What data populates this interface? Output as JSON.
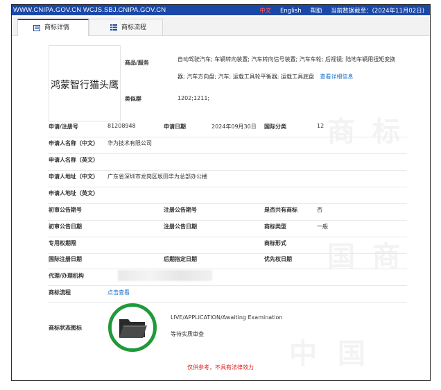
{
  "topbar": {
    "url": "WWW.CNIPA.GOV.CN WCJS.SBJ.CNIPA.GOV.CN",
    "lang_zh": "中文",
    "lang_en": "English",
    "help": "帮助",
    "data_date": "当前数据截至：(2024年11月02日)"
  },
  "tabs": [
    {
      "label": "商标详情",
      "icon": "document-icon",
      "active": true
    },
    {
      "label": "商标流程",
      "icon": "list-icon",
      "active": false
    }
  ],
  "mark": {
    "text": "鸿蒙智行猫头鹰"
  },
  "goods": {
    "label": "商品/服务",
    "text": "自动驾驶汽车; 车辆转向装置; 汽车转向信号装置; 汽车车轮; 后视镜; 陆地车辆用扭矩变换器; 汽车方向盘; 汽车; 运载工具轮平衡器; 运载工具底盘",
    "more_link": "查看详细信息"
  },
  "similar_group": {
    "label": "类似群",
    "value": "1202;1211;"
  },
  "fields": {
    "reg_no_label": "申请/注册号",
    "reg_no": "81208948",
    "app_date_label": "申请日期",
    "app_date": "2024年09月30日",
    "intl_class_label": "国际分类",
    "intl_class": "12",
    "applicant_cn_label": "申请人名称（中文）",
    "applicant_cn": "华为技术有限公司",
    "applicant_en_label": "申请人名称（英文）",
    "address_cn_label": "申请人地址（中文）",
    "address_cn": "广东省深圳市龙岗区坂田华为总部办公楼",
    "address_en_label": "申请人地址（英文）",
    "prelim_no_label": "初审公告期号",
    "reg_notice_no_label": "注册公告期号",
    "shared_label": "是否共有商标",
    "shared": "否",
    "prelim_date_label": "初审公告日期",
    "reg_notice_date_label": "注册公告日期",
    "mark_type_label": "商标类型",
    "mark_type": "一般",
    "exclusive_label": "专用权期限",
    "mark_form_label": "商标形式",
    "intl_reg_date_label": "国际注册日期",
    "later_designation_label": "后期指定日期",
    "priority_date_label": "优先权日期",
    "agent_label": "代理/办理机构",
    "flow_label": "商标流程",
    "flow_link": "点击查看",
    "status_icon_label": "商标状态图标"
  },
  "status": {
    "en": "LIVE/APPLICATION/Awaiting Examination",
    "cn": "等待实质审查",
    "icon": "folder-icon",
    "ring_color": "#1f9a3a"
  },
  "notice": "仅供参考，不具有法律效力",
  "colors": {
    "brand": "#1a48a8",
    "link": "#1a70c8",
    "warning": "#e02020"
  }
}
